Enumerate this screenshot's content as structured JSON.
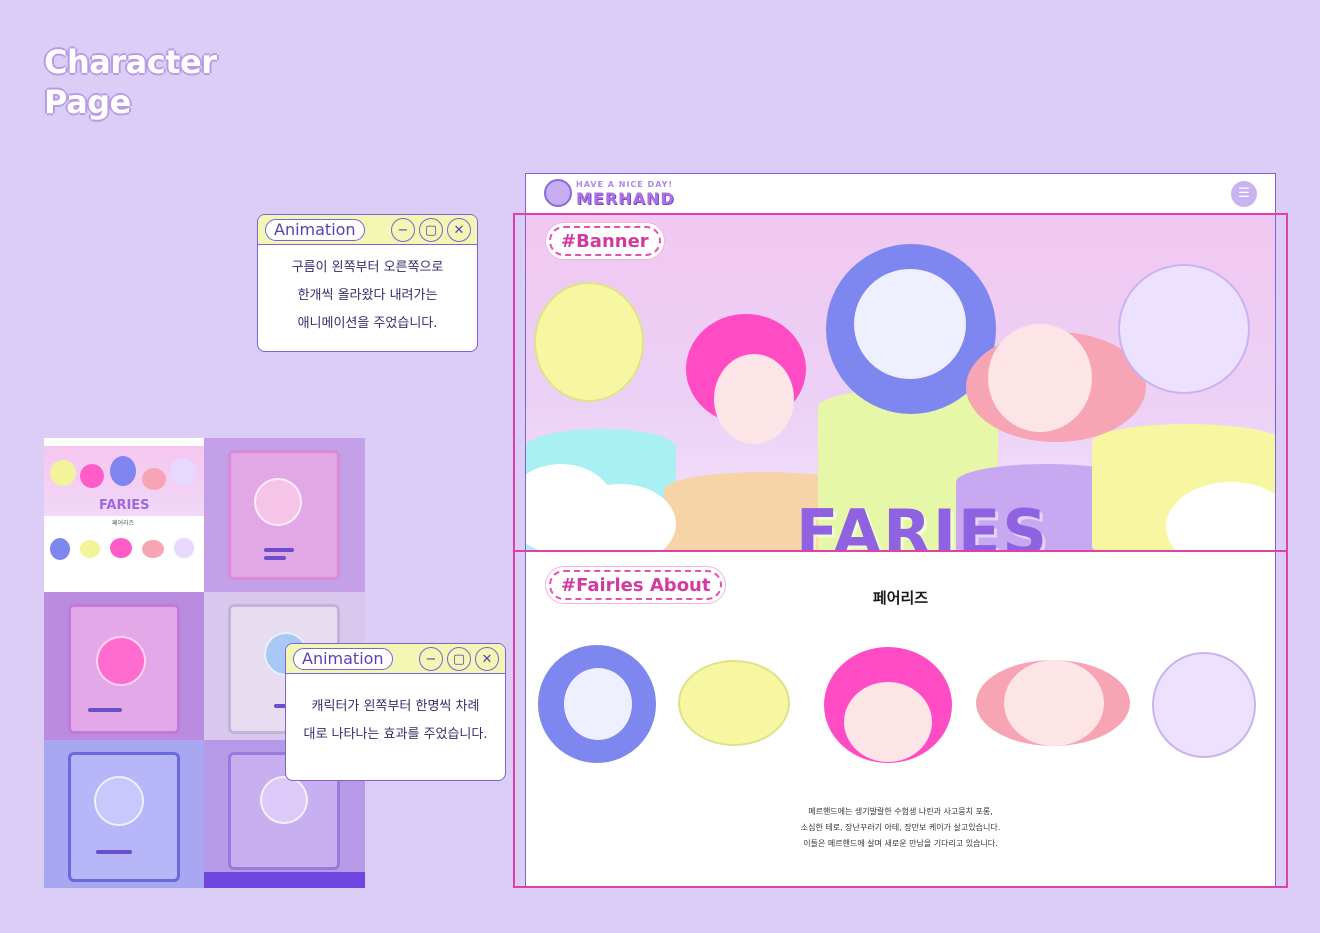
{
  "page_heading": {
    "line1": "Character",
    "line2": "Page"
  },
  "popups": [
    {
      "tag": "Animation",
      "lines": [
        "구름이 왼쪽부터 오른쪽으로",
        "한개씩 올라왔다 내려가는",
        "애니메이션을 주었습니다."
      ]
    },
    {
      "tag": "Animation",
      "lines": [
        "캐릭터가 왼쪽부터 한명씩 차례",
        "대로 나타나는 효과를 주었습니다."
      ]
    }
  ],
  "mockup": {
    "logo_tagline": "HAVE A NICE DAY!",
    "logo_name": "MERHAND",
    "menu_icon": "cart-menu-icon",
    "banner": {
      "hashtag": "#Banner",
      "title": "FARIES"
    },
    "about": {
      "hashtag": "#Fairles About",
      "title": "페어리즈",
      "desc": [
        "메르핸드에는 생기발랄한 수험생 나린과 사고뭉치 포롱,",
        "소심한 테로, 장난꾸러기 아테, 장만보 케이가 살고있습니다.",
        "이들은 메르핸드에 살며 새로운 만남을 기다리고 있습니다."
      ]
    }
  },
  "thumbnail_sheet": {
    "title": "FARIES",
    "subtitle": "페어리즈"
  },
  "colors": {
    "background": "#dccdf6",
    "accent": "#e23fa8",
    "outline": "#7d62d8",
    "popup_bar": "#f3f7b4"
  }
}
